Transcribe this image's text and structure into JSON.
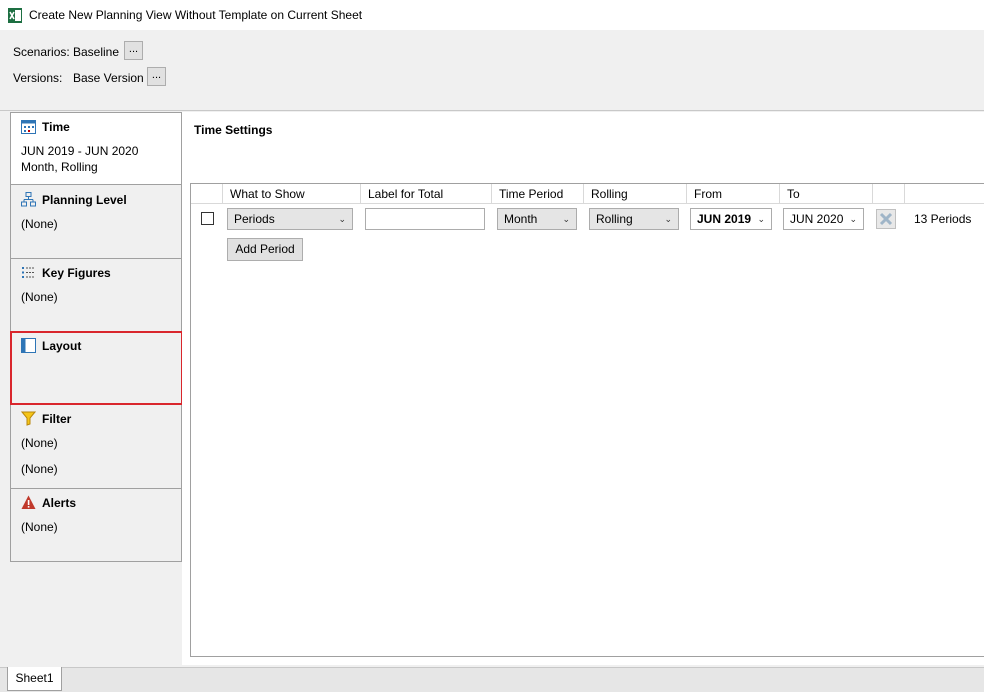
{
  "window": {
    "title": "Create New Planning View Without Template on Current Sheet"
  },
  "selectors": {
    "scenarios_label": "Scenarios:",
    "scenarios_value": "Baseline",
    "versions_label": "Versions:",
    "versions_value": "Base Version",
    "ellipsis": "..."
  },
  "sidebar": {
    "time": {
      "title": "Time",
      "line1": "JUN 2019 - JUN 2020",
      "line2": "Month, Rolling"
    },
    "planning_level": {
      "title": "Planning Level",
      "line1": "(None)"
    },
    "key_figures": {
      "title": "Key Figures",
      "line1": "(None)"
    },
    "layout": {
      "title": "Layout"
    },
    "filter": {
      "title": "Filter",
      "line1": "(None)",
      "line2": "(None)"
    },
    "alerts": {
      "title": "Alerts",
      "line1": "(None)"
    }
  },
  "time_settings": {
    "title": "Time Settings",
    "columns": [
      "What to Show",
      "Label for Total",
      "Time Period",
      "Rolling",
      "From",
      "To"
    ],
    "row": {
      "what_to_show": "Periods",
      "label_for_total": "",
      "time_period": "Month",
      "rolling": "Rolling",
      "from": "JUN 2019",
      "to": "JUN 2020",
      "count": "13 Periods"
    },
    "add_period": "Add Period"
  },
  "footer": {
    "sheet_tab": "Sheet1"
  },
  "colors": {
    "highlight": "#d9262c",
    "excel_green": "#1d6f42"
  }
}
